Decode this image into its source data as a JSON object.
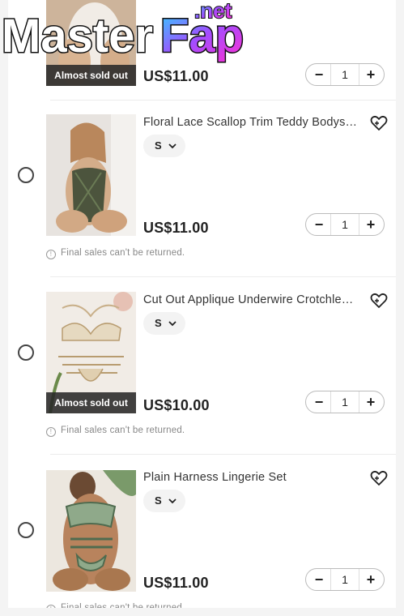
{
  "watermark": {
    "text": "MasterFap",
    "suffix": ".net"
  },
  "items": [
    {
      "title": "",
      "size": "",
      "price": "US$11.00",
      "badge": "Almost sold out",
      "quantity": "1",
      "note": ""
    },
    {
      "title": "Floral Lace Scallop Trim Teddy Bodysuit",
      "size": "S",
      "price": "US$11.00",
      "badge": "",
      "quantity": "1",
      "note": "Final sales can't be returned."
    },
    {
      "title": "Cut Out Applique Underwire Crotchless...",
      "size": "S",
      "price": "US$10.00",
      "badge": "Almost sold out",
      "quantity": "1",
      "note": "Final sales can't be returned."
    },
    {
      "title": "Plain Harness Lingerie Set",
      "size": "S",
      "price": "US$11.00",
      "badge": "",
      "quantity": "1",
      "note": "Final sales can't be returned."
    }
  ],
  "controls": {
    "minus": "−",
    "plus": "+"
  },
  "icons": {
    "heart": "heart-plus-icon",
    "chevron": "chevron-down-icon",
    "info": "info-icon",
    "radio": "radio-circle"
  },
  "colors": {
    "badge_bg": "#282828",
    "text": "#222222",
    "muted": "#888888"
  }
}
